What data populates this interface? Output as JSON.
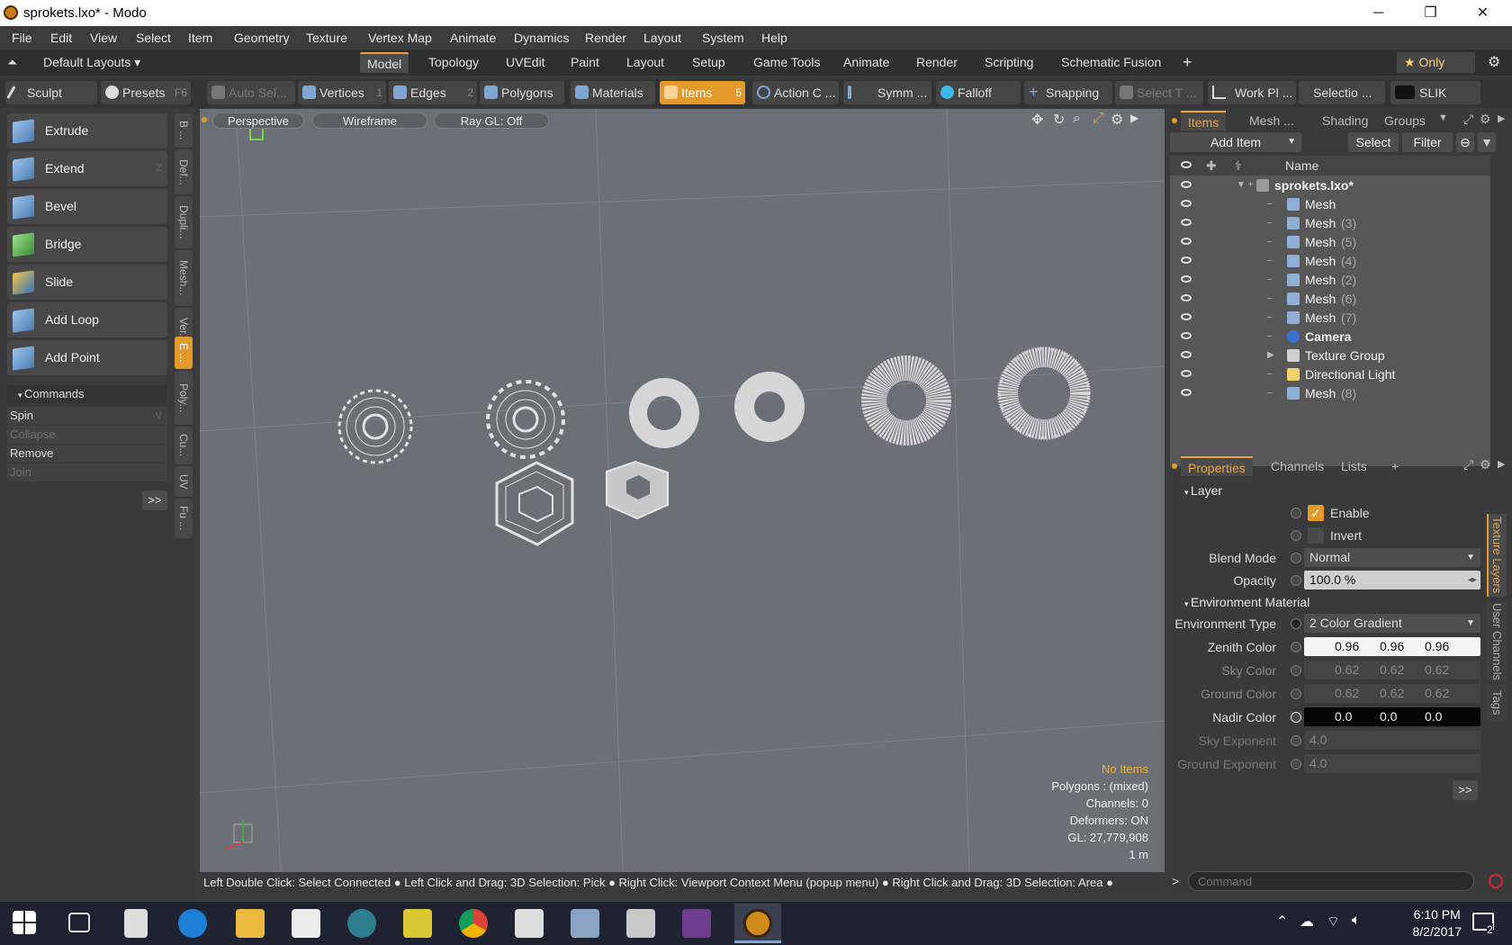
{
  "window": {
    "title": "sprokets.lxo* - Modo",
    "minimize": "─",
    "maximize": "❐",
    "close": "✕"
  },
  "menu": [
    "File",
    "Edit",
    "View",
    "Select",
    "Item",
    "Geometry",
    "Texture",
    "Vertex Map",
    "Animate",
    "Dynamics",
    "Render",
    "Layout",
    "System",
    "Help"
  ],
  "layout_bar": {
    "layouts_label": "Default Layouts ▾",
    "tabs": [
      "Model",
      "Topology",
      "UVEdit",
      "Paint",
      "Layout",
      "Setup",
      "Game Tools",
      "Animate",
      "Render",
      "Scripting",
      "Schematic Fusion"
    ],
    "active_tab": "Model",
    "add": "+",
    "only_label": "★  Only"
  },
  "toolbar": {
    "sculpt": "Sculpt",
    "presets": "Presets",
    "presets_key": "F6",
    "auto_select": "Auto Sel...",
    "vertices": "Vertices",
    "vertices_num": "1",
    "edges": "Edges",
    "edges_num": "2",
    "polygons": "Polygons",
    "materials": "Materials",
    "items": "Items",
    "items_num": "5",
    "action_center": "Action C ...",
    "symmetry": "Symm ...",
    "falloff": "Falloff",
    "snapping": "Snapping",
    "select_tools": "Select T ...",
    "work_plane": "Work Pl ...",
    "selection_sets": "Selectio ...",
    "slik": "SLIK"
  },
  "tools": [
    {
      "label": "Extrude",
      "key": ""
    },
    {
      "label": "Extend",
      "key": "Z"
    },
    {
      "label": "Bevel",
      "key": ""
    },
    {
      "label": "Bridge",
      "key": ""
    },
    {
      "label": "Slide",
      "key": ""
    },
    {
      "label": "Add Loop",
      "key": ""
    },
    {
      "label": "Add Point",
      "key": ""
    }
  ],
  "commands": {
    "header": "Commands",
    "items": [
      {
        "label": "Spin",
        "key": "V",
        "enabled": true
      },
      {
        "label": "Collapse",
        "key": "",
        "enabled": false
      },
      {
        "label": "Remove",
        "key": "",
        "enabled": true
      },
      {
        "label": "Join",
        "key": "",
        "enabled": false
      }
    ],
    "more": ">>"
  },
  "side_tabs": [
    "B ...",
    "Def...",
    "Dupli...",
    "Mesh...",
    "Ver...",
    "E ...",
    "Poly...",
    "Cu...",
    "UV",
    "Fu ..."
  ],
  "viewport": {
    "perspective": "Perspective",
    "wireframe": "Wireframe",
    "raygl": "Ray GL: Off",
    "info": {
      "no_items": "No Items",
      "polygons": "Polygons : (mixed)",
      "channels": "Channels: 0",
      "deformers": "Deformers: ON",
      "gl": "GL: 27,779,908",
      "scale": "1 m"
    }
  },
  "status_bar": "Left Double Click: Select Connected ● Left Click and Drag: 3D Selection: Pick ● Right Click: Viewport Context Menu (popup menu) ● Right Click and Drag: 3D Selection: Area ●",
  "items_panel": {
    "tabs": [
      "Items",
      "Mesh ...",
      "Shading",
      "Groups"
    ],
    "add_item": "Add Item",
    "select": "Select",
    "filter": "Filter",
    "column_name": "Name",
    "rows": [
      {
        "name": "sprokets.lxo*",
        "idx": "",
        "bold": true,
        "indent": 0,
        "icon": "scene-icon"
      },
      {
        "name": "Mesh",
        "idx": "",
        "bold": false,
        "indent": 1,
        "icon": "mesh-icon"
      },
      {
        "name": "Mesh",
        "idx": "(3)",
        "bold": false,
        "indent": 1,
        "icon": "mesh-icon"
      },
      {
        "name": "Mesh",
        "idx": "(5)",
        "bold": false,
        "indent": 1,
        "icon": "mesh-icon"
      },
      {
        "name": "Mesh",
        "idx": "(4)",
        "bold": false,
        "indent": 1,
        "icon": "mesh-icon"
      },
      {
        "name": "Mesh",
        "idx": "(2)",
        "bold": false,
        "indent": 1,
        "icon": "mesh-icon"
      },
      {
        "name": "Mesh",
        "idx": "(6)",
        "bold": false,
        "indent": 1,
        "icon": "mesh-icon"
      },
      {
        "name": "Mesh",
        "idx": "(7)",
        "bold": false,
        "indent": 1,
        "icon": "mesh-icon"
      },
      {
        "name": "Camera",
        "idx": "",
        "bold": true,
        "indent": 1,
        "icon": "camera-icon"
      },
      {
        "name": "Texture Group",
        "idx": "",
        "bold": false,
        "indent": 1,
        "icon": "texture-group-icon"
      },
      {
        "name": "Directional Light",
        "idx": "",
        "bold": false,
        "indent": 1,
        "icon": "light-icon"
      },
      {
        "name": "Mesh",
        "idx": "(8)",
        "bold": false,
        "indent": 1,
        "icon": "mesh-icon"
      }
    ]
  },
  "properties": {
    "tabs": [
      "Properties",
      "Channels",
      "Lists",
      "+"
    ],
    "side_tabs": [
      "Texture Layers",
      "User Channels",
      "Tags"
    ],
    "layer_header": "Layer",
    "enable": "Enable",
    "invert": "Invert",
    "blend_mode_label": "Blend Mode",
    "blend_mode": "Normal",
    "opacity_label": "Opacity",
    "opacity": "100.0 %",
    "env_header": "Environment Material",
    "env_type_label": "Environment Type",
    "env_type": "2 Color Gradient",
    "zenith_label": "Zenith Color",
    "zenith": [
      "0.96",
      "0.96",
      "0.96"
    ],
    "sky_label": "Sky Color",
    "sky": [
      "0.62",
      "0.62",
      "0.62"
    ],
    "ground_label": "Ground Color",
    "ground": [
      "0.62",
      "0.62",
      "0.62"
    ],
    "nadir_label": "Nadir Color",
    "nadir": [
      "0.0",
      "0.0",
      "0.0"
    ],
    "sky_exp_label": "Sky Exponent",
    "sky_exp": "4.0",
    "ground_exp_label": "Ground Exponent",
    "ground_exp": "4.0",
    "more": ">>"
  },
  "command_line": {
    "prompt": ">",
    "placeholder": "Command"
  },
  "taskbar": {
    "time": "6:10 PM",
    "date": "8/2/2017",
    "notifications": "2"
  },
  "colors": {
    "accent": "#e39a2b",
    "viewport_bg": "#6a7075",
    "panel": "#3a3a3a",
    "taskbar": "#1f2230"
  }
}
